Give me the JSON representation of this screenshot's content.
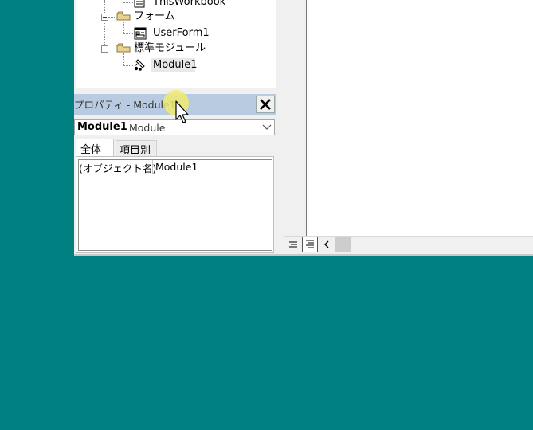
{
  "project_tree": {
    "items": [
      {
        "label": "ThisWorkbook",
        "icon": "excel-sheet-icon"
      },
      {
        "label": "フォーム",
        "icon": "folder-icon"
      },
      {
        "label": "UserForm1",
        "icon": "userform-icon"
      },
      {
        "label": "標準モジュール",
        "icon": "folder-icon"
      },
      {
        "label": "Module1",
        "icon": "module-icon"
      }
    ]
  },
  "properties": {
    "title": "プロパティ - Module1",
    "object_name": "Module1",
    "object_type": "Module",
    "tabs": [
      "全体",
      "項目別"
    ],
    "rows": [
      {
        "key": "(オブジェクト名)",
        "value": "Module1"
      }
    ]
  },
  "colors": {
    "desktop": "#008080",
    "title_bar": "#b9cbe1",
    "cursor_highlight": "#f0eb6e"
  }
}
